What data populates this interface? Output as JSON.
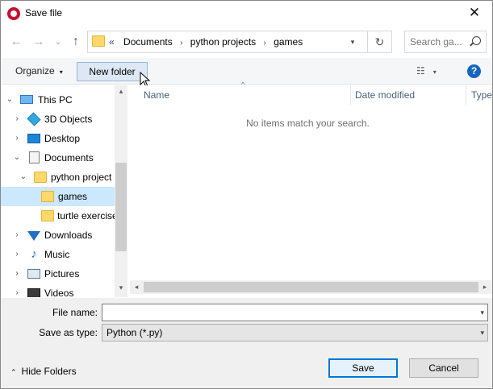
{
  "window": {
    "title": "Save file",
    "close_glyph": "✕",
    "app_icon": "feather-app-icon"
  },
  "nav": {
    "back_glyph": "←",
    "forward_glyph": "→",
    "recent_glyph": "⌄",
    "up_glyph": "↑",
    "breadcrumbs": [
      "Documents",
      "python projects",
      "games"
    ],
    "overflow_glyph": "«",
    "separator_glyph": "›",
    "dropdown_glyph": "▾",
    "refresh_glyph": "↻",
    "search_placeholder": "Search ga..."
  },
  "toolbar": {
    "organize_label": "Organize",
    "organize_caret": "▾",
    "new_folder_label": "New folder",
    "view_glyph": "☷",
    "view_caret": "▾",
    "help_glyph": "?"
  },
  "tree": {
    "items": [
      {
        "label": "This PC",
        "icon": "computer-icon",
        "expander": "⌄",
        "level": 0
      },
      {
        "label": "3D Objects",
        "icon": "3d-objects-icon",
        "expander": "›",
        "level": 1
      },
      {
        "label": "Desktop",
        "icon": "desktop-icon",
        "expander": "›",
        "level": 1
      },
      {
        "label": "Documents",
        "icon": "documents-icon",
        "expander": "⌄",
        "level": 1
      },
      {
        "label": "python project",
        "icon": "folder-icon",
        "expander": "⌄",
        "level": 2
      },
      {
        "label": "games",
        "icon": "folder-icon",
        "expander": "",
        "level": 3,
        "selected": true
      },
      {
        "label": "turtle exercise",
        "icon": "folder-icon",
        "expander": "",
        "level": 3
      },
      {
        "label": "Downloads",
        "icon": "downloads-icon",
        "expander": "›",
        "level": 1
      },
      {
        "label": "Music",
        "icon": "music-icon",
        "expander": "›",
        "level": 1
      },
      {
        "label": "Pictures",
        "icon": "pictures-icon",
        "expander": "›",
        "level": 1
      },
      {
        "label": "Videos",
        "icon": "videos-icon",
        "expander": "›",
        "level": 1
      }
    ],
    "scroll_up_glyph": "▴",
    "scroll_down_glyph": "▾"
  },
  "content": {
    "columns": [
      "Name",
      "Date modified",
      "Type"
    ],
    "sort_glyph": "^",
    "empty_message": "No items match your search.",
    "hscroll_left_glyph": "◂",
    "hscroll_right_glyph": "▸"
  },
  "form": {
    "filename_label": "File name:",
    "filename_value": "",
    "filetype_label": "Save as type:",
    "filetype_value": "Python (*.py)",
    "dropdown_glyph": "▾"
  },
  "footer": {
    "hide_folders_label": "Hide Folders",
    "hide_folders_caret": "⌃",
    "save_label": "Save",
    "cancel_label": "Cancel"
  },
  "colors": {
    "selection": "#cce8ff",
    "accent": "#0078d7",
    "help_blue": "#1565c0"
  }
}
